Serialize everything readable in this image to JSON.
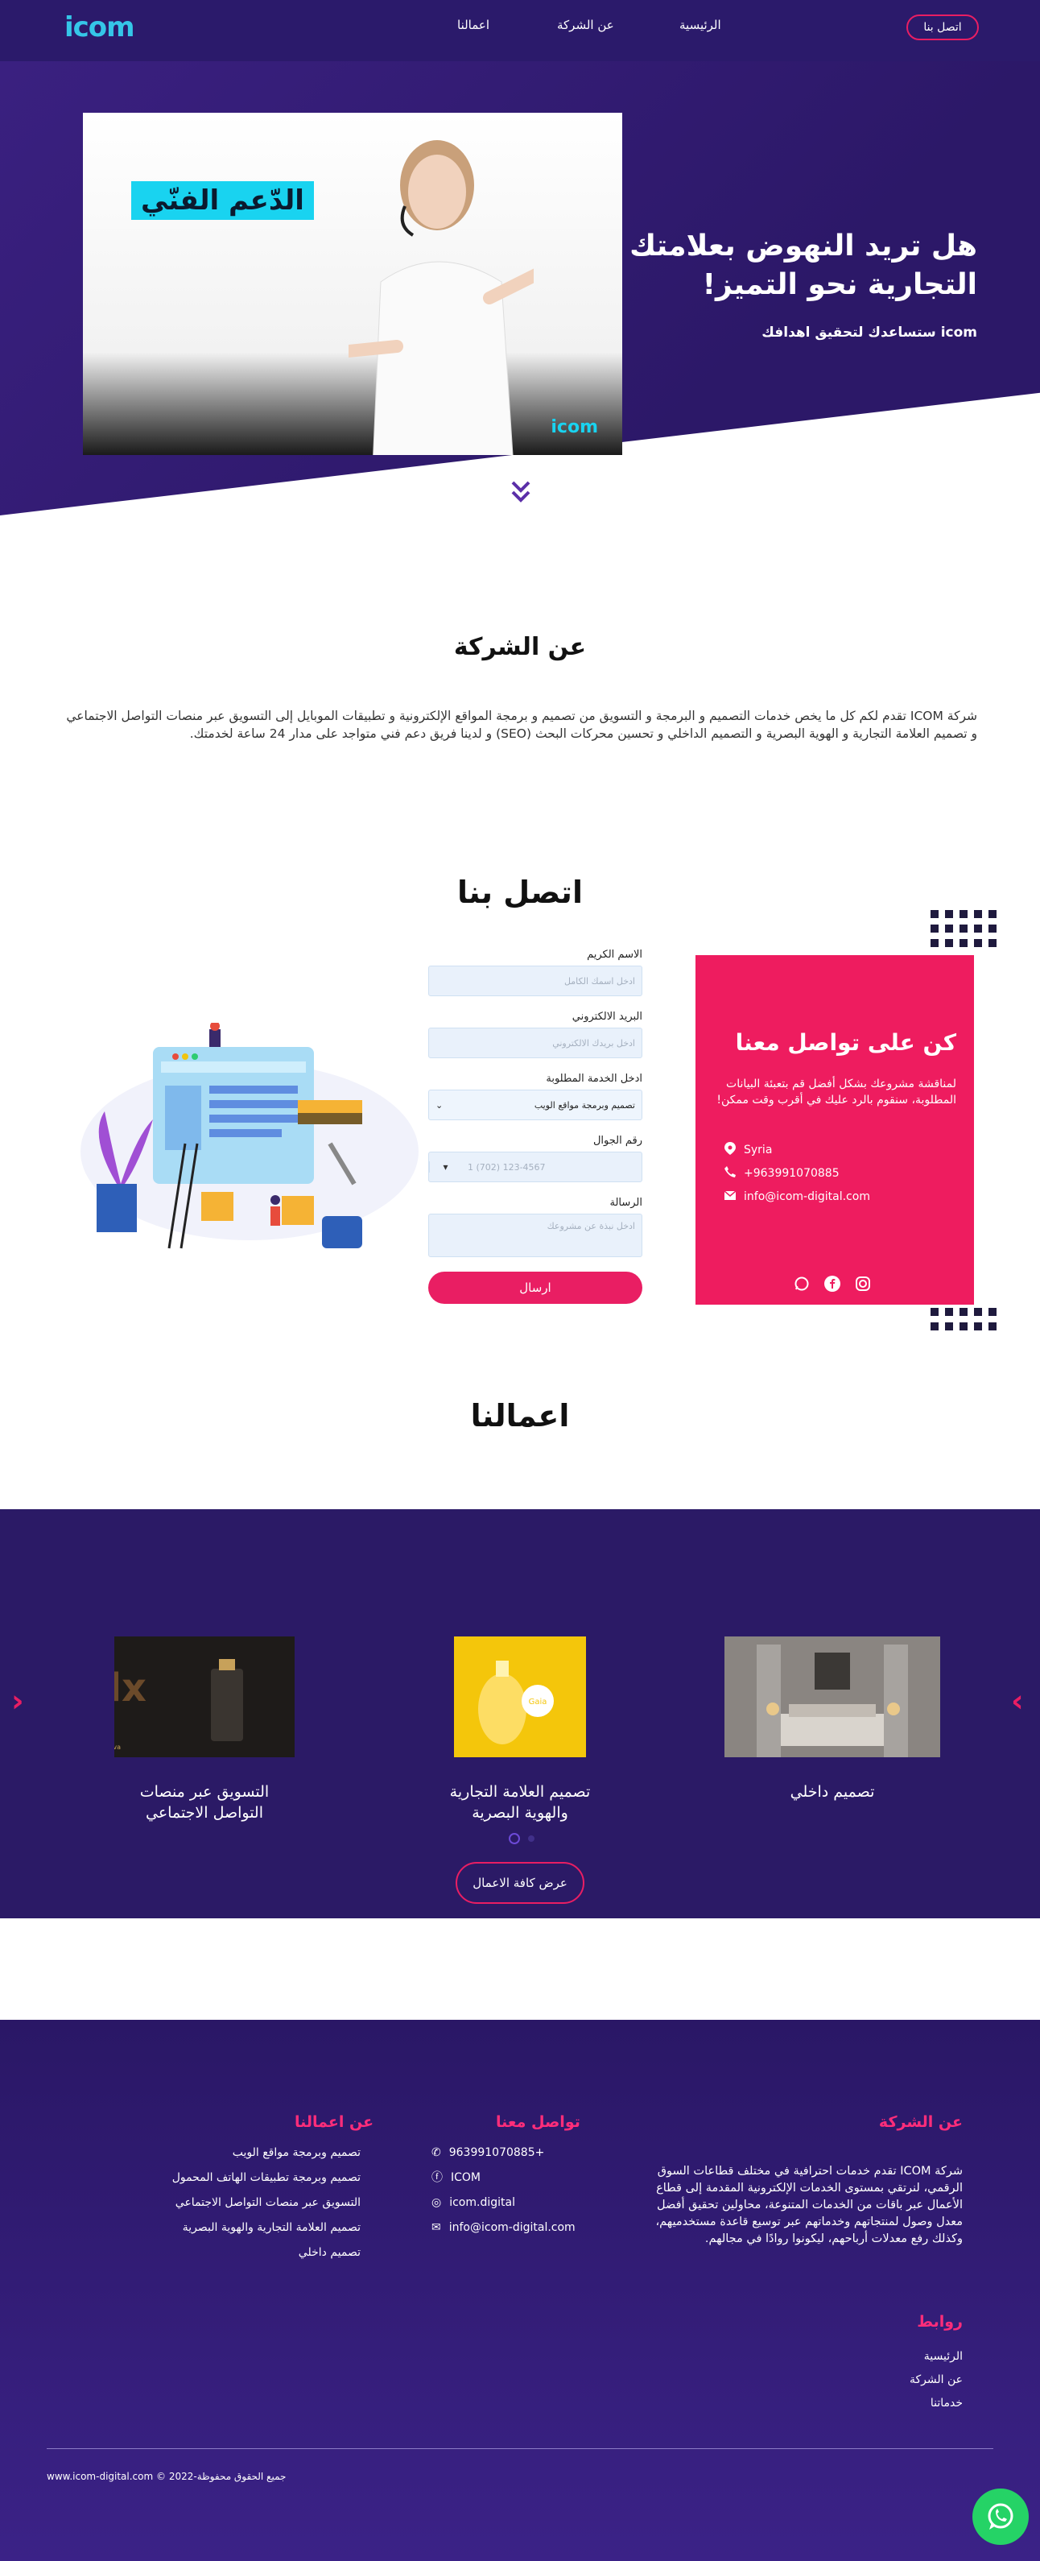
{
  "header": {
    "logo": "icom",
    "nav": [
      "الرئيسية",
      "عن الشركة",
      "اعمالنا"
    ],
    "contact_button": "اتصل بنا"
  },
  "hero": {
    "image_badge": "الدّعم الفنّي",
    "image_watermark": "icom",
    "title_line1": "هل تريد النهوض بعلامتك",
    "title_line2": "التجارية نحو التميز!",
    "subtitle": "icom ستساعدك لتحقيق اهدافك"
  },
  "about": {
    "title": "عن الشركة",
    "text": "شركة ICOM تقدم لكم كل ما يخص خدمات التصميم و البرمجة و التسويق من تصميم و برمجة المواقع الإلكترونية و تطبيقات الموبايل إلى التسويق عبر منصات التواصل الاجتماعي و تصميم العلامة التجارية و الهوية البصرية و التصميم الداخلي و تحسين محركات البحث (SEO) و لدينا فريق دعم فني متواجد على مدار 24 ساعة لخدمتك."
  },
  "contact": {
    "title": "اتصل بنا",
    "form": {
      "name_label": "الاسم الكريم",
      "name_placeholder": "ادخل اسمك الكامل",
      "email_label": "البريد الالكتروني",
      "email_placeholder": "ادخل بريدك الالكتروني",
      "service_label": "ادخل الخدمة المطلوبة",
      "service_value": "تصميم وبرمجة مواقع الويب",
      "phone_label": "رقم الجوال",
      "phone_placeholder": "1 (702) 123-4567",
      "message_label": "الرسالة",
      "message_placeholder": "ادخل نبذة عن مشروعك",
      "submit": "ارسال"
    },
    "card": {
      "title": "كن على تواصل معنا",
      "description": "لمناقشة مشروعك بشكل أفضل قم بتعبئة البيانات المطلوبة، سنقوم بالرد عليك في أقرب وقت ممكن!",
      "location": "Syria",
      "phone": "+963991070885",
      "email": "info@icom-digital.com"
    }
  },
  "works": {
    "title": "اعمالنا",
    "items": [
      {
        "caption": "تصميم داخلي"
      },
      {
        "caption_line1": "تصميم العلامة التجارية",
        "caption_line2": "والهوية البصرية"
      },
      {
        "caption_line1": "التسويق عبر منصات",
        "caption_line2": "التواصل الاجتماعي"
      }
    ],
    "all_button": "عرض كافة الاعمال"
  },
  "footer": {
    "about_title": "عن الشركة",
    "about_text": "شركة ICOM تقدم خدمات احترافية في مختلف قطاعات السوق الرقمي، لنرتقي بمستوى الخدمات الإلكترونية المقدمة إلى قطاع الأعمال عبر باقات من الخدمات المتنوعة، محاولين تحقيق أفضل معدل وصول لمنتجاتهم وخدماتهم عبر توسيع قاعدة مستخدميهم، وكذلك رفع معدلات أرباحهم، ليكونوا روادًا في مجالهم.",
    "contact_title": "تواصل معنا",
    "contact_items": [
      "+963991070885",
      "ICOM",
      "icom.digital",
      "info@icom-digital.com"
    ],
    "works_title": "عن اعمالنا",
    "works_items": [
      "تصميم وبرمجة مواقع الويب",
      "تصميم وبرمجة تطبيقات الهاتف المحمول",
      "التسويق عبر منصات التواصل الاجتماعي",
      "تصميم العلامة التجارية والهوية البصرية",
      "تصميم داخلي"
    ],
    "links_title": "روابط",
    "links": [
      "الرئيسية",
      "عن الشركة",
      "خدماتنا"
    ],
    "copyright": "www.icom-digital.com © 2022-جميع الحقوق محفوظة"
  },
  "colors": {
    "brand_purple": "#2b1a6b",
    "accent_pink": "#e91e63",
    "logo_cyan": "#35c6e8",
    "whatsapp_green": "#25d366"
  }
}
